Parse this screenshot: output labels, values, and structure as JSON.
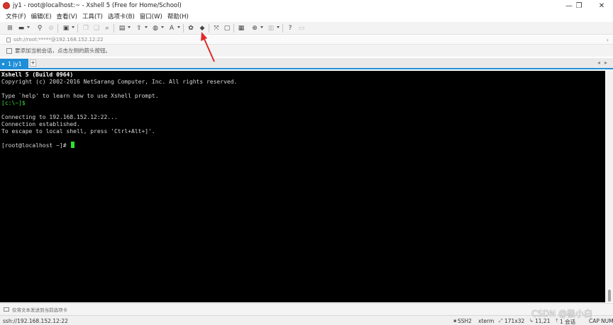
{
  "window": {
    "title": "jy1 - root@localhost:~ - Xshell 5 (Free for Home/School)",
    "controls": {
      "minimize": "—",
      "maximize": "❐",
      "close": "✕"
    }
  },
  "menu": {
    "items": [
      "文件(F)",
      "编辑(E)",
      "查看(V)",
      "工具(T)",
      "选项卡(B)",
      "窗口(W)",
      "帮助(H)"
    ]
  },
  "toolbar": {
    "icons": {
      "new_session": "⊞",
      "open": "▬",
      "reconnect": "⚲",
      "disconnect": "⊘",
      "properties": "▣",
      "copy": "❐",
      "paste": "❑",
      "find": "⌕",
      "print": "▤",
      "transfer": "⇪",
      "globe": "◍",
      "font": "A",
      "xftp": "✿",
      "xftp_new": "◆",
      "fullscreen": "⤧",
      "lock": "▢",
      "keyboard": "▦",
      "add": "⊕",
      "layout": "▥",
      "help": "?",
      "chat": "▭"
    }
  },
  "address": {
    "text": "ssh://root:*****@192.168.152.12:22",
    "arrow": "›"
  },
  "hint": {
    "text": "要添加当前会话，点击左侧的箭头按钮。"
  },
  "tabs": {
    "active_label": "1 jy1",
    "add": "+",
    "prev": "◂",
    "next": "▸"
  },
  "terminal": {
    "lines": [
      "Xshell 5 (Build 0964)",
      "Copyright (c) 2002-2016 NetSarang Computer, Inc. All rights reserved.",
      "",
      "Type `help' to learn how to use Xshell prompt.",
      "[c:\\~]$",
      "",
      "Connecting to 192.168.152.12:22...",
      "Connection established.",
      "To escape to local shell, press 'Ctrl+Alt+]'.",
      "",
      "[root@localhost ~]# "
    ]
  },
  "compose": {
    "text": "仅将文本发送到当前选项卡"
  },
  "status": {
    "connection": "ssh://192.168.152.12:22",
    "protocol": "SSH2",
    "terminal_type": "xterm",
    "size": "171x32",
    "cursor_pos": "11,21",
    "sessions": "1 会话",
    "caps": "CAP",
    "num": "NUM"
  },
  "watermark": {
    "text": "CSDN @极小白"
  },
  "colors": {
    "tab_accent": "#1e8ed8",
    "terminal_bg": "#000000",
    "prompt_green": "#39e239",
    "annotation_red": "#e0292c"
  }
}
